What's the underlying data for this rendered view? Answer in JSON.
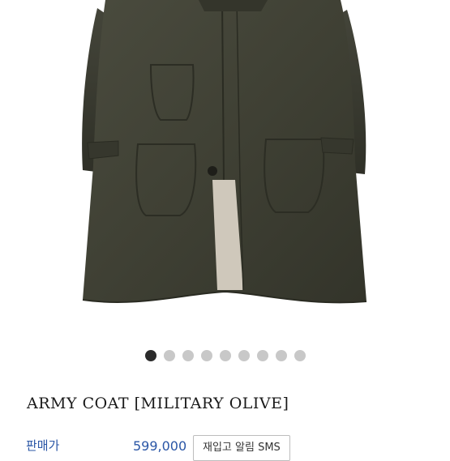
{
  "product": {
    "title": "ARMY COAT [MILITARY OLIVE]",
    "price_label": "판매가",
    "price": "599,000",
    "restock_sms_button": "재입고 알림 SMS"
  },
  "carousel": {
    "total": 9,
    "active_index": 1
  },
  "colors": {
    "coat_olive": "#3f4034",
    "price_blue": "#2a56a6",
    "dot_active": "#2b2b2b",
    "dot_inactive": "#c8c8c8"
  }
}
